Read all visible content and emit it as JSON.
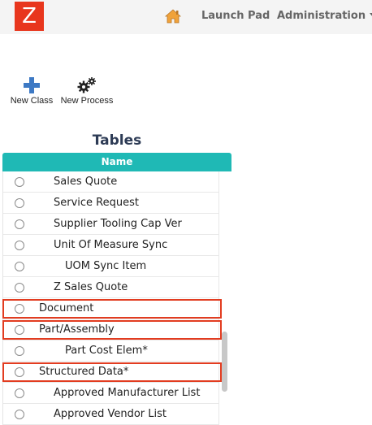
{
  "header": {
    "logo_letter": "Z",
    "home_icon": "home-icon",
    "launch_pad": "Launch Pad",
    "administration": "Administration"
  },
  "toolbar": {
    "new_class": "New Class",
    "new_process": "New Process"
  },
  "tables": {
    "title": "Tables",
    "column_name": "Name",
    "rows": [
      {
        "label": "Sales Quote",
        "level": 1,
        "highlighted": false
      },
      {
        "label": "Service Request",
        "level": 1,
        "highlighted": false
      },
      {
        "label": "Supplier Tooling Cap Ver",
        "level": 1,
        "highlighted": false
      },
      {
        "label": "Unit Of Measure Sync",
        "level": 1,
        "highlighted": false
      },
      {
        "label": "UOM Sync Item",
        "level": 2,
        "highlighted": false
      },
      {
        "label": "Z Sales Quote",
        "level": 1,
        "highlighted": false
      },
      {
        "label": "Document",
        "level": 0,
        "highlighted": true
      },
      {
        "label": "Part/Assembly",
        "level": 0,
        "highlighted": true
      },
      {
        "label": "Part Cost Elem*",
        "level": 2,
        "highlighted": false
      },
      {
        "label": "Structured Data*",
        "level": 0,
        "highlighted": true
      },
      {
        "label": "Approved Manufacturer List",
        "level": 1,
        "highlighted": false
      },
      {
        "label": "Approved Vendor List",
        "level": 1,
        "highlighted": false
      }
    ]
  },
  "colors": {
    "logo": "#e8361d",
    "header_teal": "#1fb9b5",
    "highlight": "#e23c20",
    "title": "#2d3b55"
  }
}
